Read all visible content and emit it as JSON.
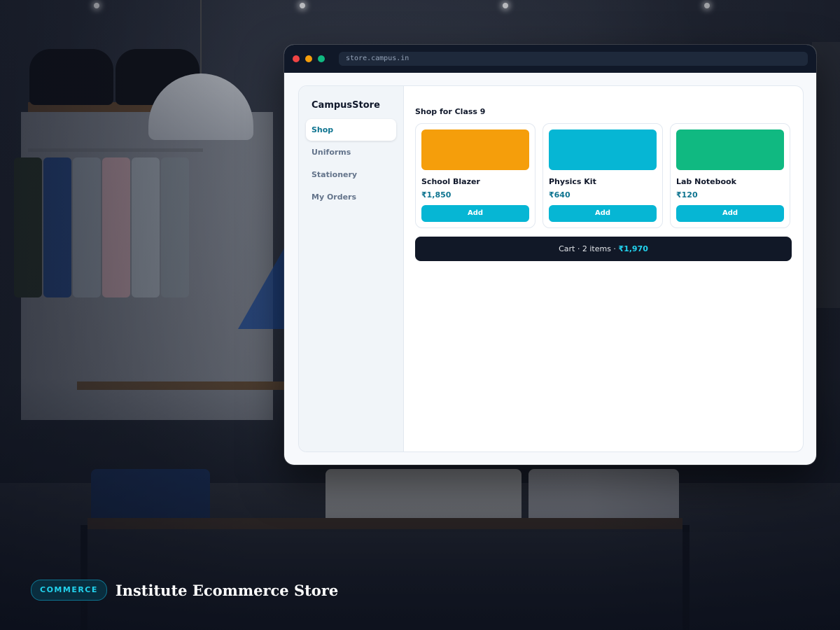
{
  "browser": {
    "url": "store.campus.in"
  },
  "sidebar": {
    "brand": "CampusStore",
    "items": [
      {
        "label": "Shop",
        "active": true
      },
      {
        "label": "Uniforms",
        "active": false
      },
      {
        "label": "Stationery",
        "active": false
      },
      {
        "label": "My Orders",
        "active": false
      }
    ]
  },
  "main": {
    "heading": "Shop for Class 9",
    "products": [
      {
        "name": "School Blazer",
        "price": "₹1,850",
        "button": "Add",
        "color": "#f59e0b"
      },
      {
        "name": "Physics Kit",
        "price": "₹640",
        "button": "Add",
        "color": "#06b6d4"
      },
      {
        "name": "Lab Notebook",
        "price": "₹120",
        "button": "Add",
        "color": "#10b981"
      }
    ],
    "cart": {
      "label": "Cart · 2 items ·",
      "total": "₹1,970"
    }
  },
  "caption": {
    "badge": "COMMERCE",
    "title": "Institute Ecommerce Store"
  },
  "colors": {
    "accent": "#06b6d4",
    "price_text": "#0e7490",
    "cart_bar": "#111827",
    "titlebar": "#101828"
  }
}
